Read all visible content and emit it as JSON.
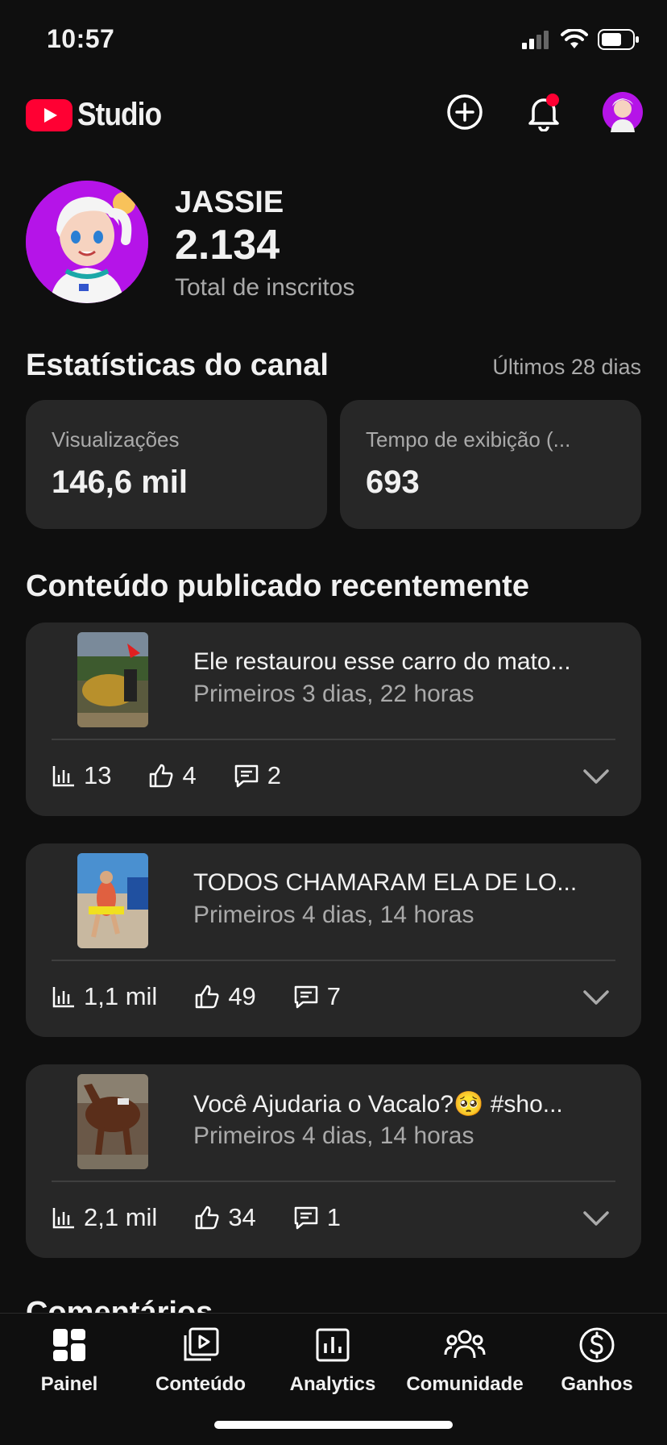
{
  "status_bar": {
    "time": "10:57"
  },
  "header": {
    "logo_text": "Studio"
  },
  "channel": {
    "name": "JASSIE",
    "subscribers": "2.134",
    "subscribers_label": "Total de inscritos"
  },
  "channel_stats": {
    "title": "Estatísticas do canal",
    "period": "Últimos 28 dias",
    "cards": [
      {
        "label": "Visualizações",
        "value": "146,6 mil"
      },
      {
        "label": "Tempo de exibição (...",
        "value": "693"
      }
    ]
  },
  "recent": {
    "title": "Conteúdo publicado recentemente",
    "videos": [
      {
        "title": "Ele restaurou esse carro do mato...",
        "meta": "Primeiros 3 dias, 22 horas",
        "views": "13",
        "likes": "4",
        "comments": "2"
      },
      {
        "title": "TODOS CHAMARAM ELA DE LO...",
        "meta": "Primeiros 4 dias, 14 horas",
        "views": "1,1 mil",
        "likes": "49",
        "comments": "7"
      },
      {
        "title": "Você Ajudaria o Vacalo?🥺 #sho...",
        "meta": "Primeiros 4 dias, 14 horas",
        "views": "2,1 mil",
        "likes": "34",
        "comments": "1"
      }
    ]
  },
  "next_section": {
    "title": "Comentários"
  },
  "nav": {
    "items": [
      {
        "label": "Painel",
        "icon": "dashboard-icon"
      },
      {
        "label": "Conteúdo",
        "icon": "content-icon"
      },
      {
        "label": "Analytics",
        "icon": "analytics-icon"
      },
      {
        "label": "Comunidade",
        "icon": "community-icon"
      },
      {
        "label": "Ganhos",
        "icon": "earn-icon"
      }
    ]
  },
  "colors": {
    "background": "#0f0f0f",
    "card": "#272727",
    "brand_red": "#ff0033",
    "secondary_text": "#aaaaaa",
    "avatar_bg": "#b514e8"
  }
}
